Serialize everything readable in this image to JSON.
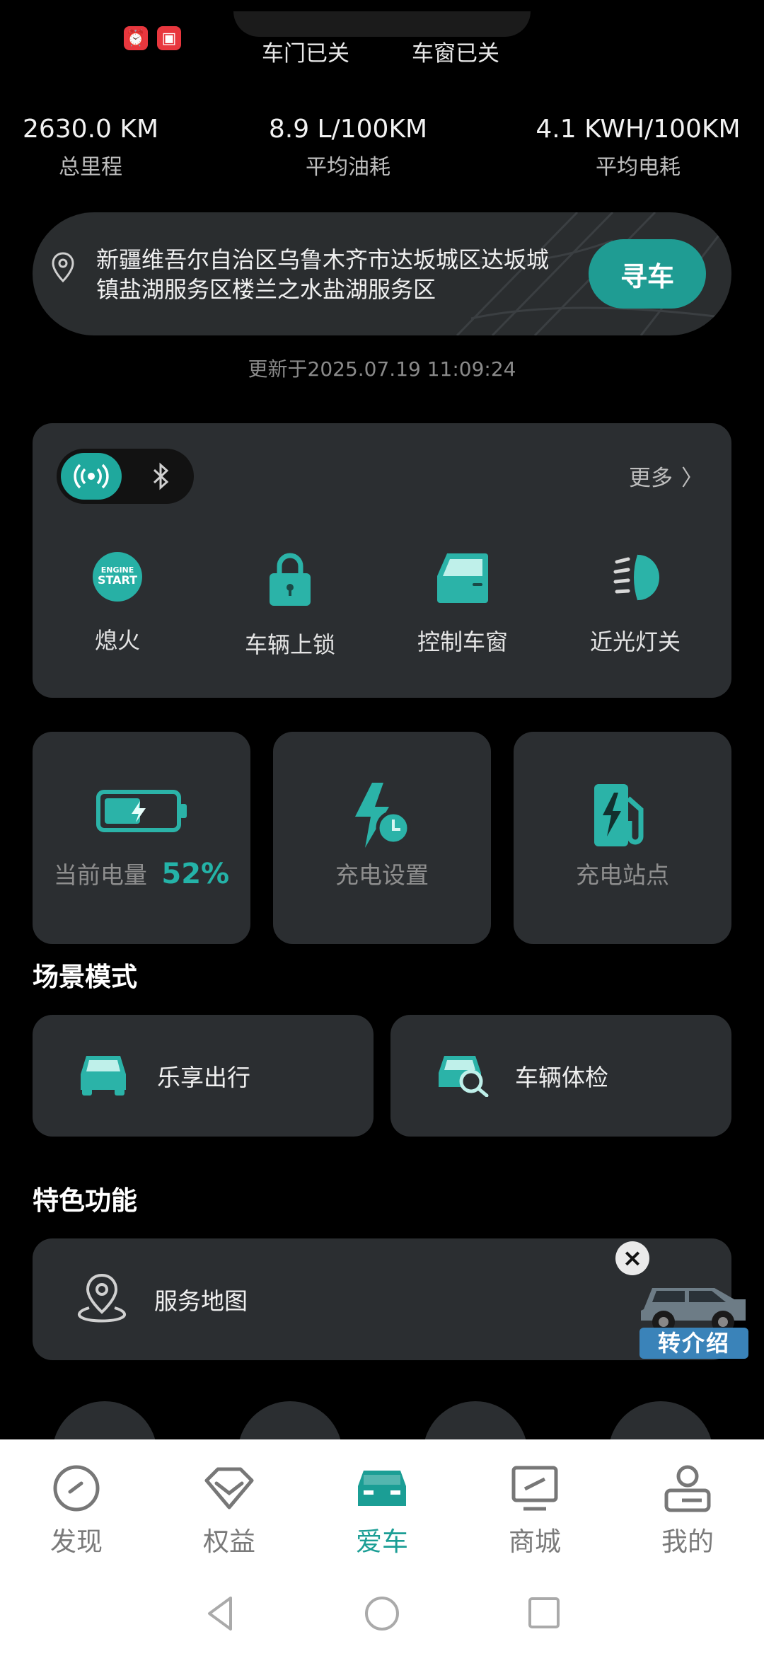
{
  "status": {
    "door": "车门已关",
    "window": "车窗已关"
  },
  "stats": [
    {
      "value": "2630.0 KM",
      "label": "总里程"
    },
    {
      "value": "8.9 L/100KM",
      "label": "平均油耗"
    },
    {
      "value": "4.1 KWH/100KM",
      "label": "平均电耗"
    }
  ],
  "location": {
    "address": "新疆维吾尔自治区乌鲁木齐市达坂城区达坂城镇盐湖服务区楼兰之水盐湖服务区",
    "find_button": "寻车",
    "updated": "更新于2025.07.19 11:09:24"
  },
  "controls": {
    "more": "更多",
    "items": [
      {
        "label": "熄火",
        "icon": "engine-start-icon"
      },
      {
        "label": "车辆上锁",
        "icon": "lock-icon"
      },
      {
        "label": "控制车窗",
        "icon": "car-door-icon"
      },
      {
        "label": "近光灯关",
        "icon": "headlight-icon"
      }
    ]
  },
  "tiles": {
    "battery_label": "当前电量",
    "battery_value": "52%",
    "battery_level": 0.52,
    "charge_settings": "充电设置",
    "charge_station": "充电站点"
  },
  "scene": {
    "title": "场景模式",
    "items": [
      {
        "label": "乐享出行"
      },
      {
        "label": "车辆体检"
      }
    ]
  },
  "features": {
    "title": "特色功能",
    "service_map": "服务地图"
  },
  "promo": {
    "label": "转介绍"
  },
  "nav": {
    "items": [
      {
        "label": "发现"
      },
      {
        "label": "权益"
      },
      {
        "label": "爱车"
      },
      {
        "label": "商城"
      },
      {
        "label": "我的"
      }
    ]
  },
  "colors": {
    "accent": "#24B3A8",
    "card": "#2B2E31",
    "background": "#000000"
  }
}
